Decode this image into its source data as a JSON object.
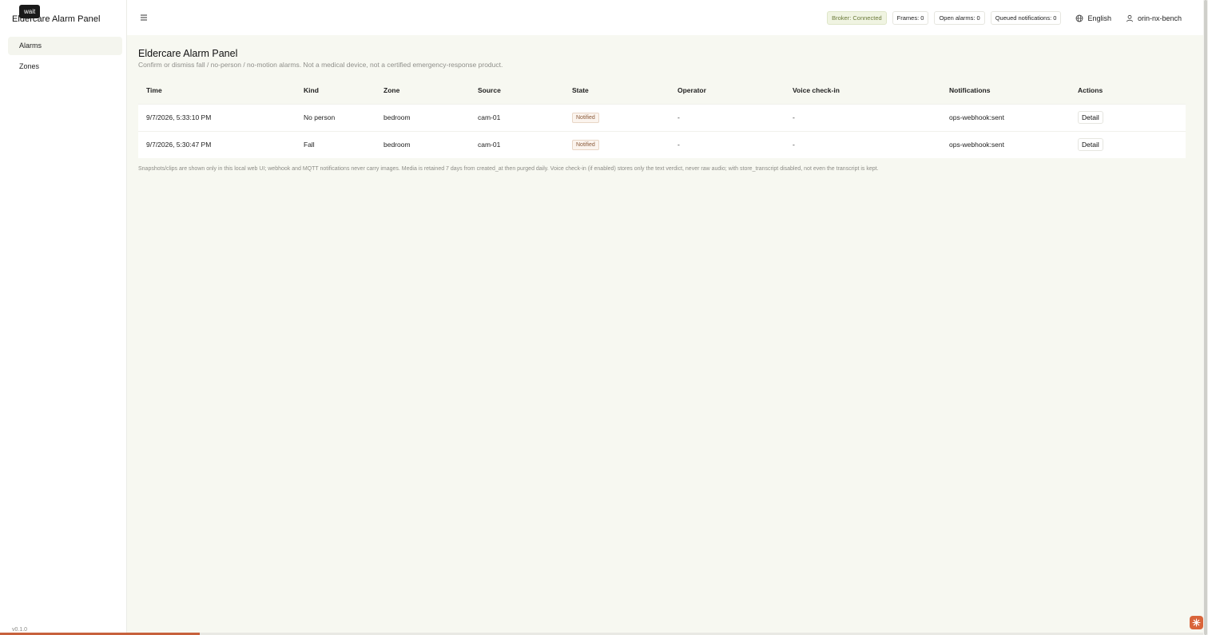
{
  "tooltip": "wait",
  "app_title": "Eldercare Alarm Panel",
  "sidebar": {
    "items": [
      {
        "label": "Alarms"
      },
      {
        "label": "Zones"
      }
    ],
    "version": "v0.1.0"
  },
  "header": {
    "badges": {
      "broker": "Broker: Connected",
      "frames": "Frames: 0",
      "open_alarms": "Open alarms: 0",
      "queued": "Queued notifications: 0"
    },
    "language": "English",
    "user": "orin-nx-bench"
  },
  "main": {
    "title": "Eldercare Alarm Panel",
    "subtitle": "Confirm or dismiss fall / no-person / no-motion alarms. Not a medical device, not a certified emergency-response product.",
    "table": {
      "headers": [
        "Time",
        "Kind",
        "Zone",
        "Source",
        "State",
        "Operator",
        "Voice check-in",
        "Notifications",
        "Actions"
      ],
      "rows": [
        {
          "time": "9/7/2026, 5:33:10 PM",
          "kind": "No person",
          "zone": "bedroom",
          "source": "cam-01",
          "state": "Notified",
          "operator": "-",
          "voice": "-",
          "notifications": "ops-webhook:sent",
          "action": "Detail"
        },
        {
          "time": "9/7/2026, 5:30:47 PM",
          "kind": "Fall",
          "zone": "bedroom",
          "source": "cam-01",
          "state": "Notified",
          "operator": "-",
          "voice": "-",
          "notifications": "ops-webhook:sent",
          "action": "Detail"
        }
      ]
    },
    "footnote": "Snapshots/clips are shown only in this local web UI; webhook and MQTT notifications never carry images. Media is retained 7 days from created_at then purged daily. Voice check-in (if enabled) stores only the text verdict, never raw audio; with store_transcript disabled, not even the transcript is kept."
  },
  "page_load_progress": 0.166,
  "colors": {
    "accent": "#c7613c",
    "ok_badge": "#6b7a3a",
    "state_badge": "#8a5a3a"
  }
}
